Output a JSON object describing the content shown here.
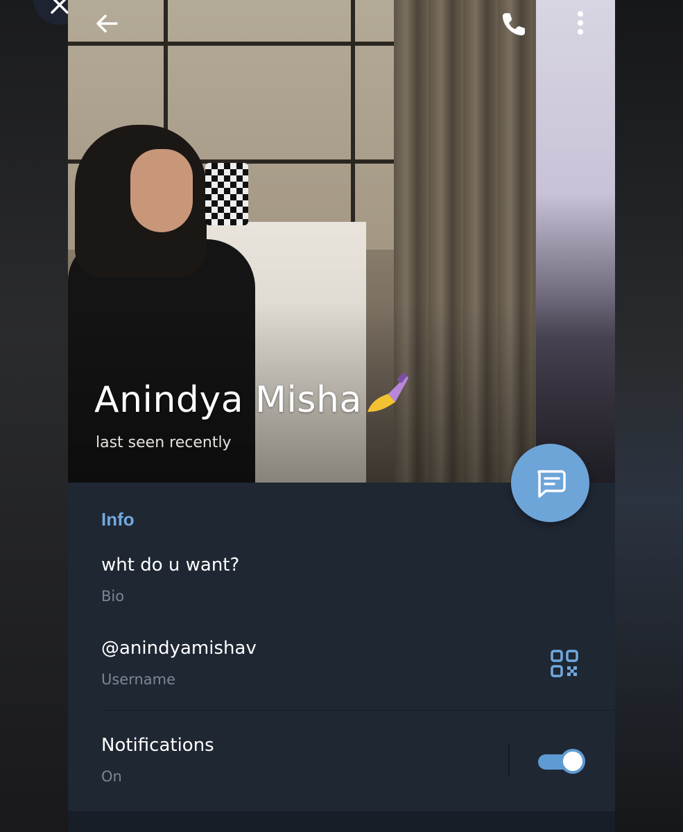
{
  "profile": {
    "name": "Anindya Misha",
    "status": "last seen recently"
  },
  "info": {
    "section_title": "Info",
    "bio": {
      "value": "wht do u want?",
      "label": "Bio"
    },
    "username": {
      "value": "@anindyamishav",
      "label": "Username"
    },
    "notifications": {
      "value": "Notifications",
      "label": "On",
      "enabled": true
    }
  },
  "icons": {
    "close": "close-icon",
    "back": "arrow-left-icon",
    "call": "phone-icon",
    "more": "more-vertical-icon",
    "message": "message-icon",
    "qr": "qr-code-icon",
    "emoji": "nail-polish-emoji"
  },
  "colors": {
    "accent": "#71a9df",
    "fab": "#6ea5d9",
    "panel": "#1f2733",
    "secondary_text": "#7b8796"
  }
}
